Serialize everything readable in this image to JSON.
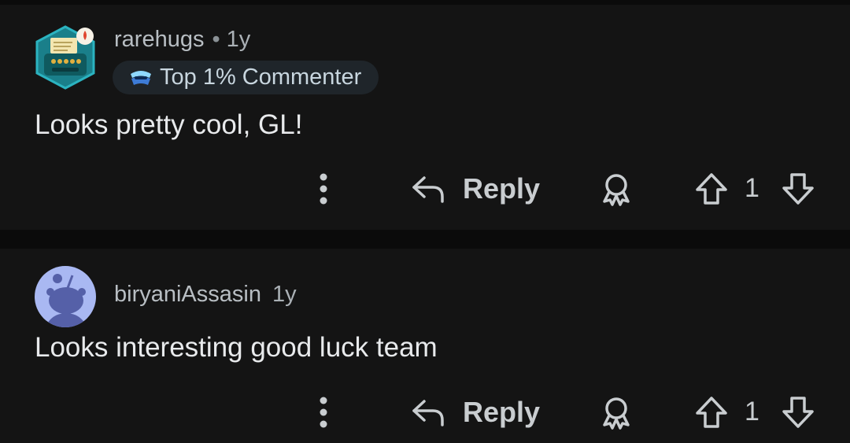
{
  "comments": [
    {
      "username": "rarehugs",
      "separator": "•",
      "age": "1y",
      "flair": "Top 1% Commenter",
      "text": "Looks pretty cool, GL!",
      "reply_label": "Reply",
      "score": "1",
      "avatar": "typewriter-avatar-icon"
    },
    {
      "username": "biryaniAssasin",
      "age": "1y",
      "text": "Looks interesting good luck team",
      "reply_label": "Reply",
      "score": "1",
      "avatar": "default-snoo-avatar-icon"
    }
  ],
  "colors": {
    "background": "#0b0b0b",
    "card": "#141414",
    "text": "#e8eaec",
    "muted": "#b8bec3",
    "flair_bg": "#1f252a"
  }
}
